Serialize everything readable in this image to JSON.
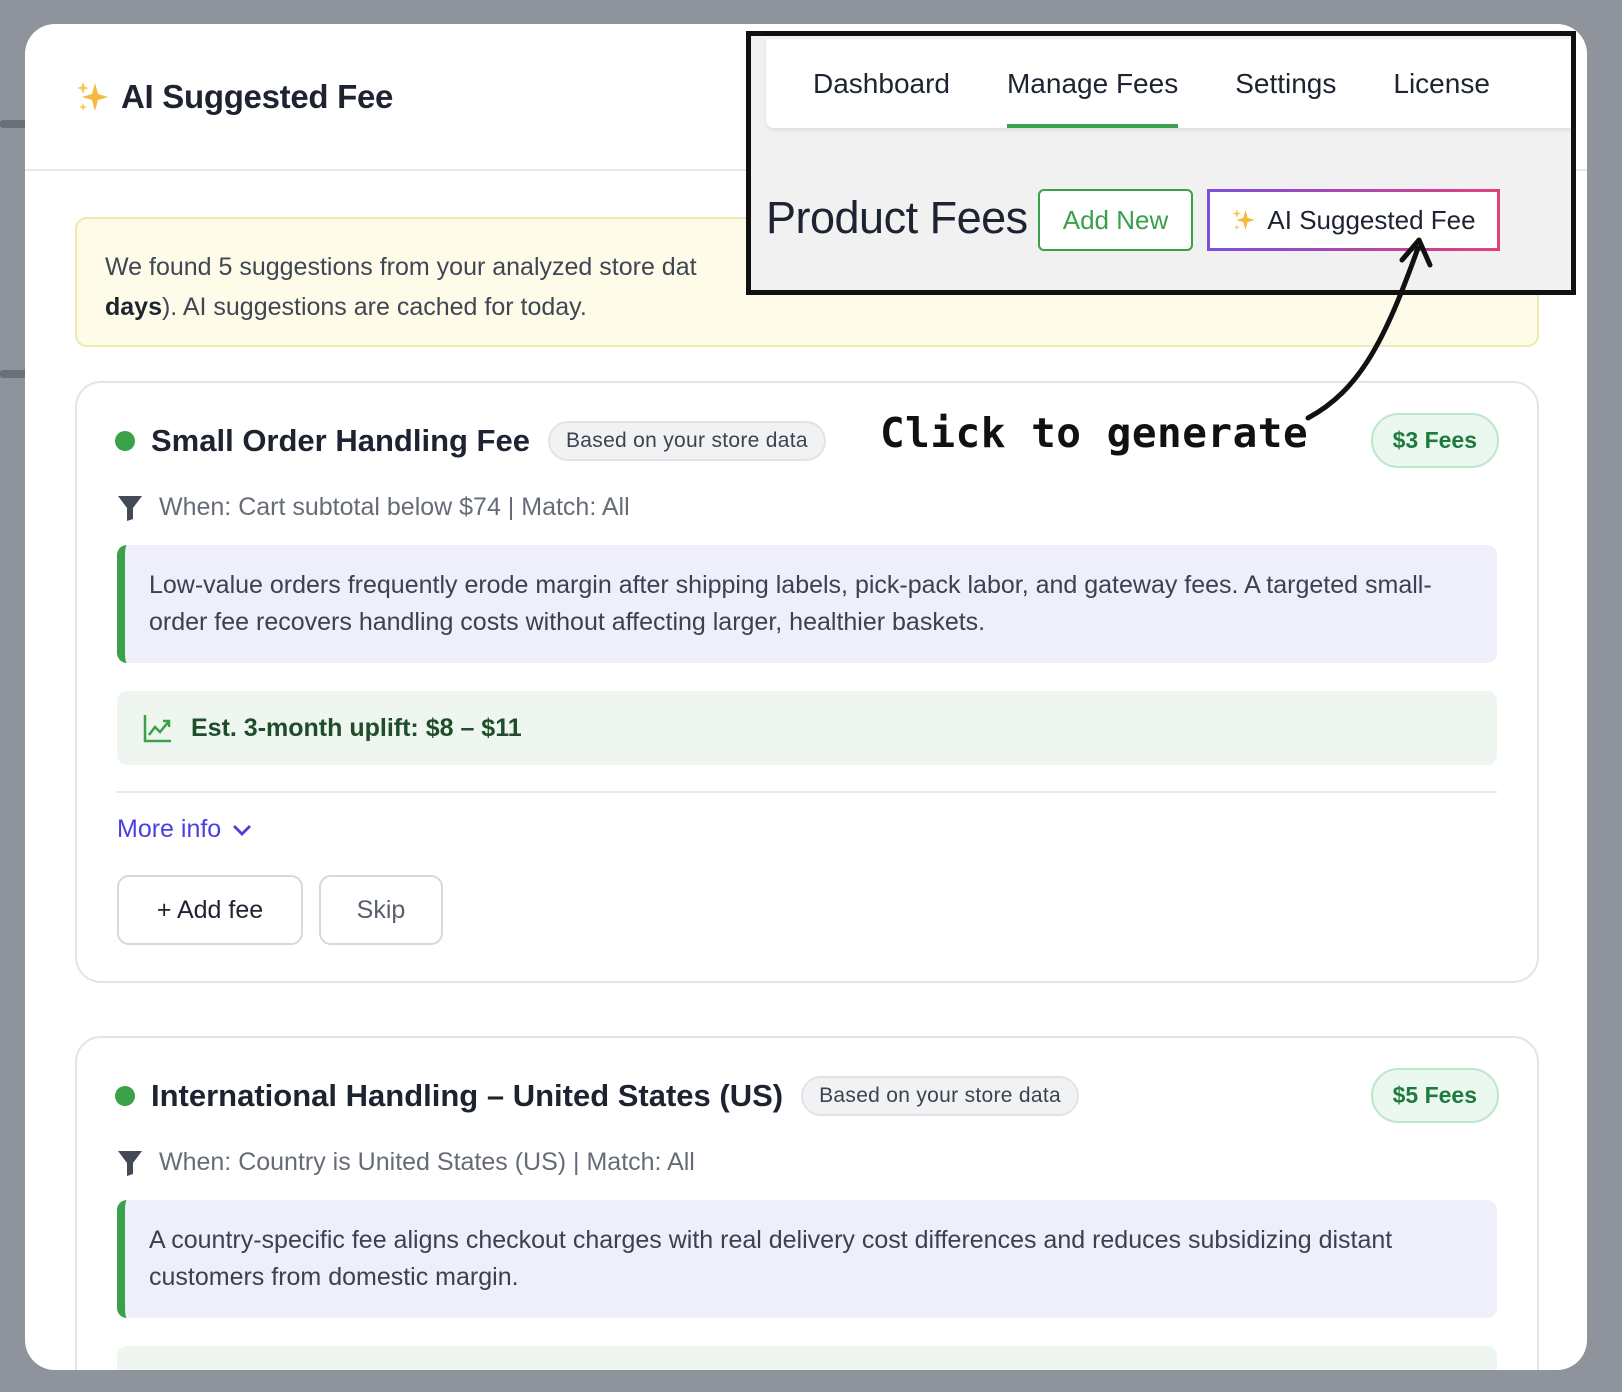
{
  "modal": {
    "title": "AI Suggested Fee",
    "title_icon": "sparkle-icon"
  },
  "notice": {
    "text_start": "We found 5 suggestions from your analyzed store dat",
    "bold": "days",
    "text_end": "). AI suggestions are cached for today."
  },
  "suggestions": [
    {
      "title": "Small Order Handling Fee",
      "source_badge": "Based on your store data",
      "fee_badge": "$3 Fees",
      "condition": "When: Cart subtotal below $74 | Match: All",
      "reason": "Low-value orders frequently erode margin after shipping labels, pick-pack labor, and gateway fees. A targeted small-order fee recovers handling costs without affecting larger, healthier baskets.",
      "uplift": "Est. 3-month uplift: $8 – $11",
      "more_info": "More info",
      "add_label": "+ Add fee",
      "skip_label": "Skip"
    },
    {
      "title": "International Handling – United States (US)",
      "source_badge": "Based on your store data",
      "fee_badge": "$5 Fees",
      "condition": "When: Country is United States (US) | Match: All",
      "reason": "A country-specific fee aligns checkout charges with real delivery cost differences and reduces subsidizing distant customers from domestic margin."
    }
  ],
  "callout": {
    "tabs": [
      "Dashboard",
      "Manage Fees",
      "Settings",
      "License"
    ],
    "active_tab": "Manage Fees",
    "page_title": "Product Fees",
    "add_new_label": "Add New",
    "ai_button_label": "AI Suggested Fee"
  },
  "annotation": "Click to generate",
  "colors": {
    "accent_green": "#3aa049",
    "link_purple": "#4a3fe0",
    "ai_border": "#b955d8"
  }
}
